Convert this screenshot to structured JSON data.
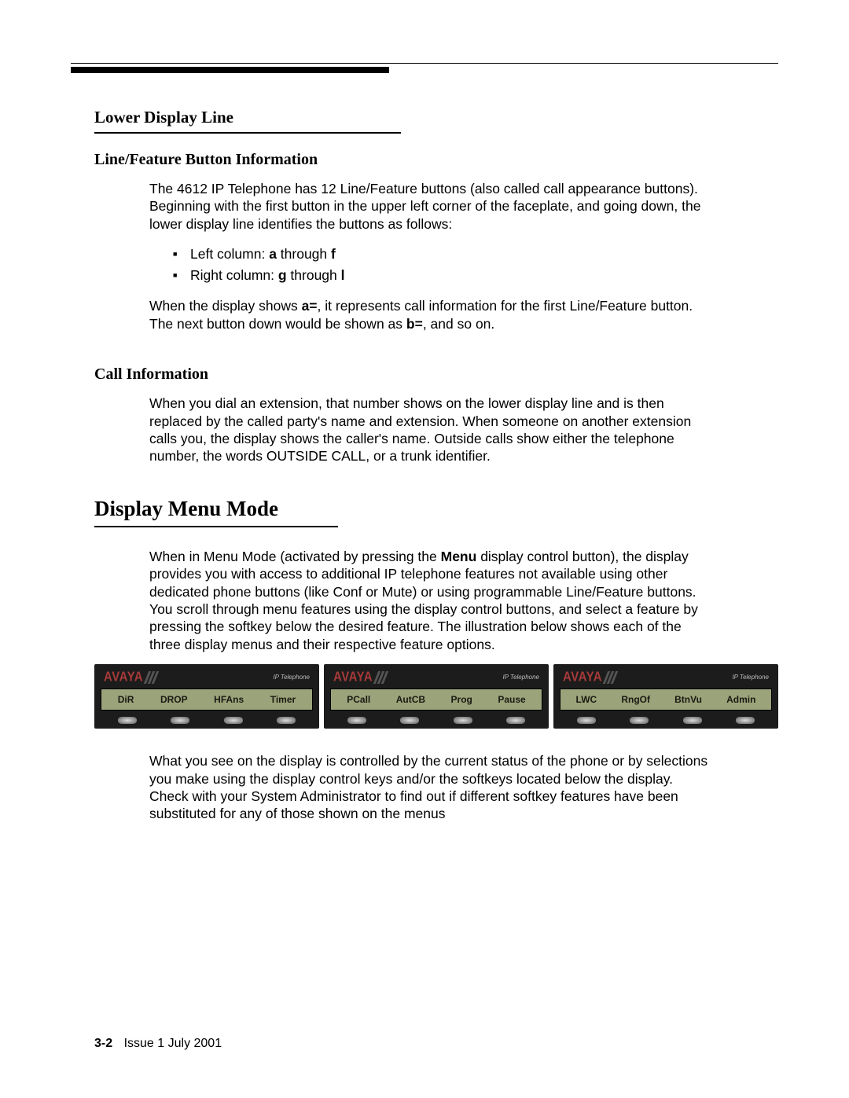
{
  "headings": {
    "h3_lower": "Lower Display Line",
    "h4_line_feature": "Line/Feature Button Information",
    "h4_call_info": "Call Information",
    "h2_display_menu": "Display Menu Mode"
  },
  "paras": {
    "p1a": "The 4612 IP Telephone has 12 Line/Feature buttons (also called call appearance buttons). Beginning with the first button in the upper left corner of the faceplate, and going down, the lower display line identifies the buttons as follows:",
    "p2_pre": "When the display shows ",
    "p2_b1": "a=",
    "p2_mid": ", it represents call information for the first Line/Feature button. The next button down would be shown as ",
    "p2_b2": "b=",
    "p2_suf": ", and so on.",
    "p3": "When you dial an extension, that number shows on the lower display line and is then replaced by the called party's name and extension. When someone on another extension calls you, the display shows the caller's name. Outside calls show either the telephone number, the words OUTSIDE CALL, or a trunk identifier.",
    "p4_pre": "When in Menu Mode (activated by pressing the ",
    "p4_b": "Menu",
    "p4_suf": " display control button), the display provides you with access to additional IP telephone features not available using other dedicated phone buttons (like Conf or Mute) or using programmable Line/Feature buttons. You scroll through menu features using the display control buttons, and select a feature by pressing the softkey below the desired feature. The illustration below shows each of the three display menus and their respective feature options.",
    "p5": "What you see on the display is controlled by the current status of the phone or by selections you make using the display control keys and/or the softkeys located below the display. Check with your System Administrator to find out if different softkey features have been substituted for any of those shown on the menus"
  },
  "bullets": {
    "b1_pre": "Left column: ",
    "b1_b1": "a",
    "b1_mid": " through ",
    "b1_b2": "f",
    "b2_pre": "Right column: ",
    "b2_b1": "g",
    "b2_mid": " through ",
    "b2_b2": "l"
  },
  "logo": "AVAYA",
  "iptel": "IP Telephone",
  "displays": {
    "d1": [
      "DiR",
      "DROP",
      "HFAns",
      "Timer"
    ],
    "d2": [
      "PCall",
      "AutCB",
      "Prog",
      "Pause"
    ],
    "d3": [
      "LWC",
      "RngOf",
      "BtnVu",
      "Admin"
    ]
  },
  "footer": {
    "page": "3-2",
    "issue": "Issue  1   July 2001"
  }
}
